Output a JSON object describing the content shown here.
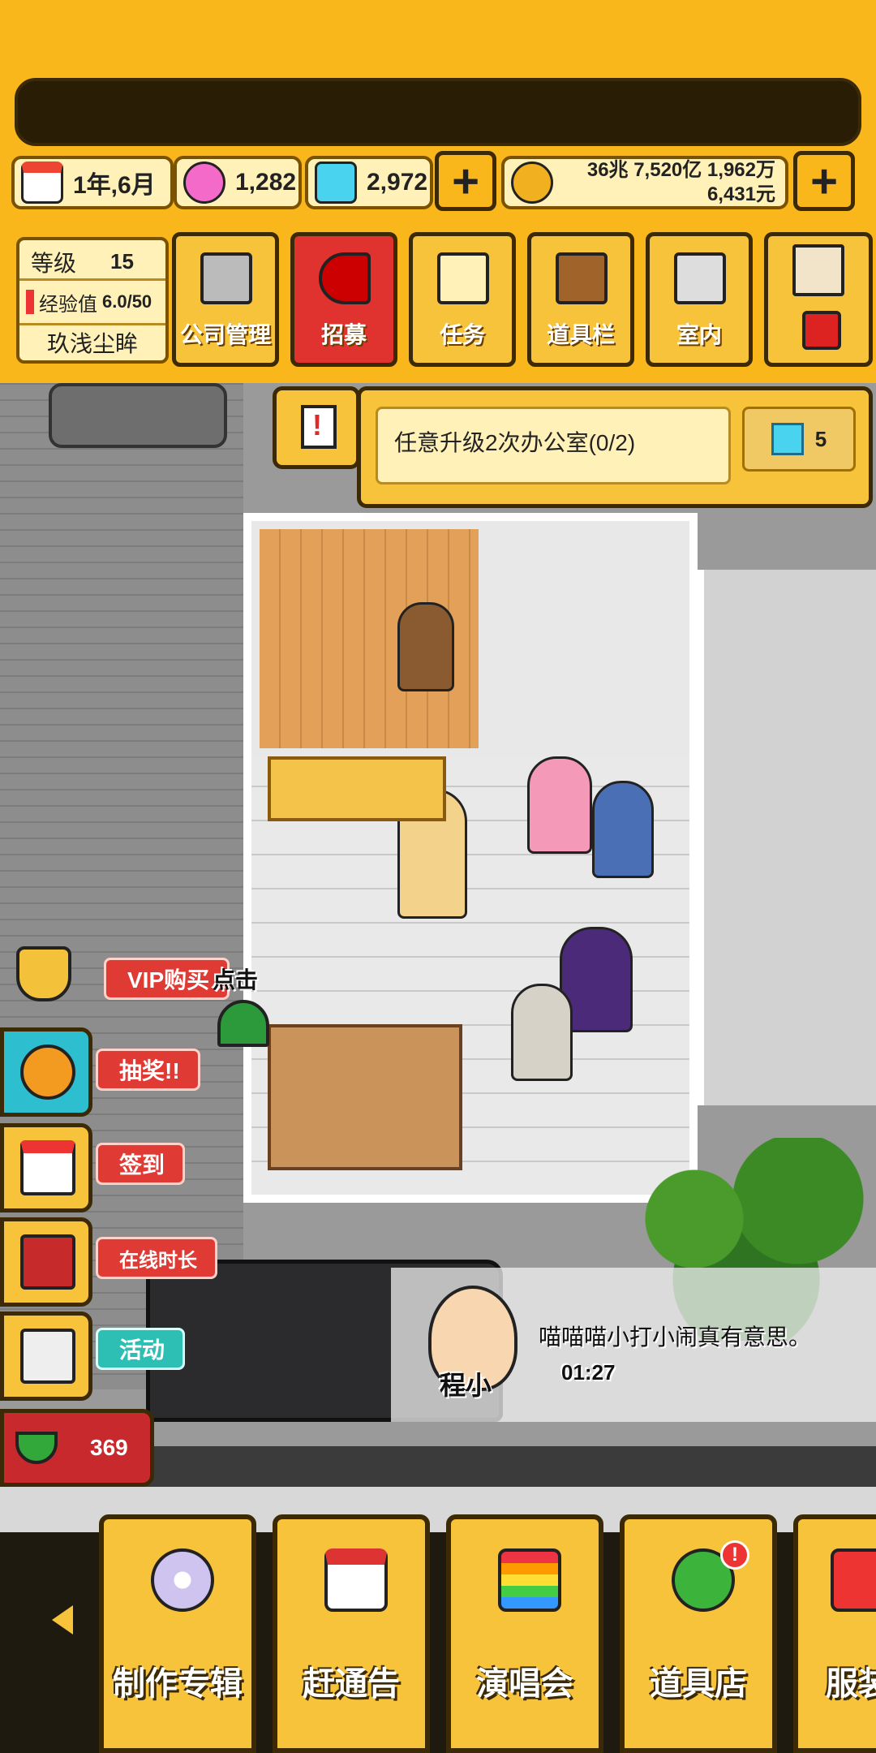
{
  "resources": {
    "date": "1年,6月",
    "pink_gems": "1,282",
    "blue_gems": "2,972",
    "money_line1": "36兆 7,520亿 1,962万",
    "money_line2": "6,431元"
  },
  "player": {
    "level_label": "等级",
    "level_value": "15",
    "exp_label": "经验值",
    "exp_value": "6.0/50",
    "name": "玖浅尘眸"
  },
  "top_menu": [
    {
      "label": "公司管理",
      "icon": "building-icon"
    },
    {
      "label": "招募",
      "icon": "megaphone-icon"
    },
    {
      "label": "任务",
      "icon": "scroll-icon"
    },
    {
      "label": "道具栏",
      "icon": "chest-icon"
    },
    {
      "label": "室内",
      "icon": "paint-roller-icon"
    },
    {
      "label": "",
      "icon": "mail-icon"
    }
  ],
  "task": {
    "text": "任意升级2次办公室(0/2)",
    "reward": "5"
  },
  "side_menu": [
    {
      "tag": "VIP购买",
      "icon": "crown-icon"
    },
    {
      "tag": "抽奖!!",
      "icon": "roulette-icon"
    },
    {
      "tag": "签到",
      "icon": "calendar-icon"
    },
    {
      "tag": "在线时长",
      "icon": "gift-icon"
    },
    {
      "tag": "活动",
      "icon": "scissors-icon"
    }
  ],
  "click_hint": "点击",
  "watermelon_count": "369",
  "chat": {
    "speaker": "程小",
    "message": "喵喵喵小打小闹真有意思。",
    "timer": "01:27"
  },
  "bottom_menu": [
    {
      "label": "制作专辑",
      "icon": "disc-icon"
    },
    {
      "label": "赶通告",
      "icon": "calendar-icon"
    },
    {
      "label": "演唱会",
      "icon": "rainbow-stage-icon"
    },
    {
      "label": "道具店",
      "icon": "clover-icon",
      "badge": "!"
    },
    {
      "label": "服装",
      "icon": "shirt-icon"
    }
  ],
  "colors": {
    "primary": "#f9b71c",
    "button": "#f7c33b",
    "border": "#3b2a05",
    "recruit": "#e0332f"
  }
}
